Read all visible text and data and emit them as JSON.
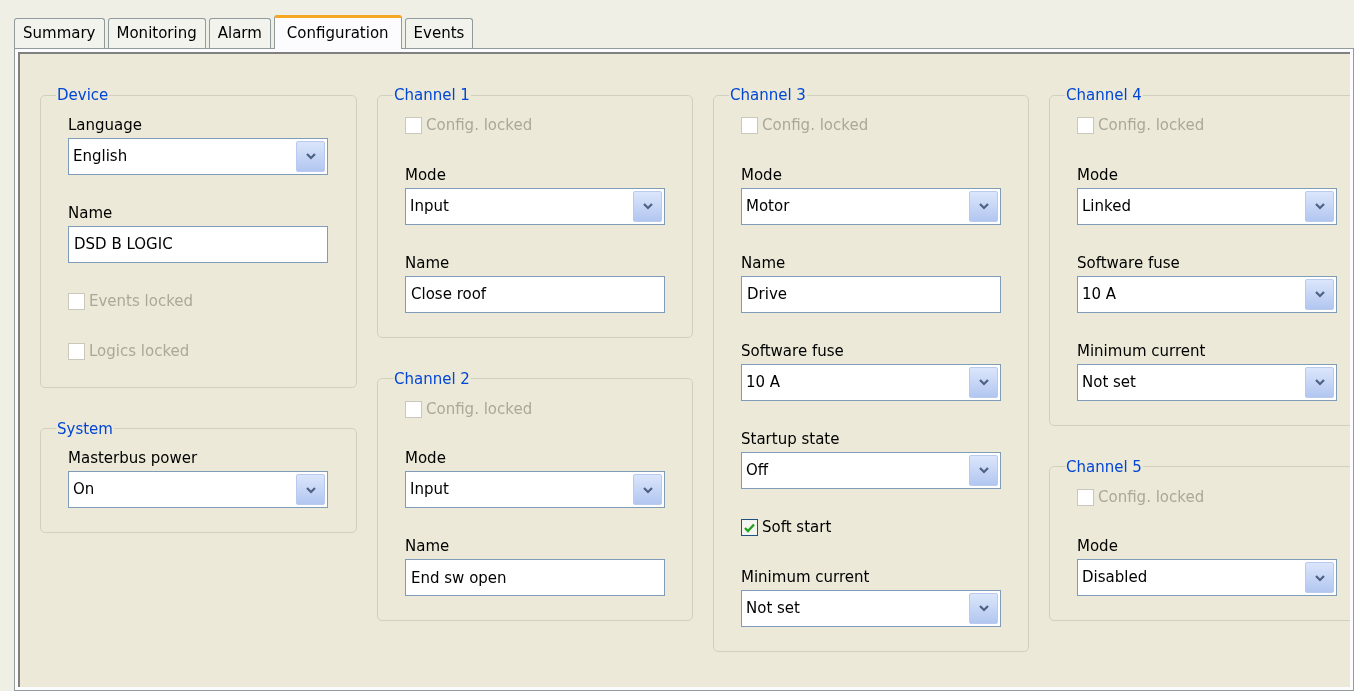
{
  "tabs": [
    {
      "label": "Summary",
      "selected": false
    },
    {
      "label": "Monitoring",
      "selected": false
    },
    {
      "label": "Alarm",
      "selected": false
    },
    {
      "label": "Configuration",
      "selected": true
    },
    {
      "label": "Events",
      "selected": false
    }
  ],
  "columns": [
    [
      {
        "title": "Device",
        "items": [
          {
            "kind": "select",
            "label": "Language",
            "value": "English"
          },
          {
            "kind": "text",
            "label": "Name",
            "value": "DSD B LOGIC"
          },
          {
            "kind": "checkbox",
            "label": "Events locked",
            "checked": false,
            "disabled": true
          },
          {
            "kind": "checkbox",
            "label": "Logics locked",
            "checked": false,
            "disabled": true
          }
        ]
      },
      {
        "title": "System",
        "items": [
          {
            "kind": "select",
            "label": "Masterbus power",
            "value": "On"
          }
        ]
      }
    ],
    [
      {
        "title": "Channel 1",
        "items": [
          {
            "kind": "checkbox",
            "label": "Config. locked",
            "checked": false,
            "disabled": true
          },
          {
            "kind": "select",
            "label": "Mode",
            "value": "Input"
          },
          {
            "kind": "text",
            "label": "Name",
            "value": "Close roof"
          }
        ]
      },
      {
        "title": "Channel 2",
        "items": [
          {
            "kind": "checkbox",
            "label": "Config. locked",
            "checked": false,
            "disabled": true
          },
          {
            "kind": "select",
            "label": "Mode",
            "value": "Input"
          },
          {
            "kind": "text",
            "label": "Name",
            "value": "End sw open"
          }
        ]
      }
    ],
    [
      {
        "title": "Channel 3",
        "items": [
          {
            "kind": "checkbox",
            "label": "Config. locked",
            "checked": false,
            "disabled": true
          },
          {
            "kind": "select",
            "label": "Mode",
            "value": "Motor"
          },
          {
            "kind": "text",
            "label": "Name",
            "value": "Drive"
          },
          {
            "kind": "select",
            "label": "Software fuse",
            "value": "10 A"
          },
          {
            "kind": "select",
            "label": "Startup state",
            "value": "Off"
          },
          {
            "kind": "checkbox",
            "label": "Soft start",
            "checked": true,
            "disabled": false
          },
          {
            "kind": "select",
            "label": "Minimum current",
            "value": "Not set"
          }
        ]
      }
    ],
    [
      {
        "title": "Channel 4",
        "items": [
          {
            "kind": "checkbox",
            "label": "Config. locked",
            "checked": false,
            "disabled": true
          },
          {
            "kind": "select",
            "label": "Mode",
            "value": "Linked"
          },
          {
            "kind": "select",
            "label": "Software fuse",
            "value": "10 A"
          },
          {
            "kind": "select",
            "label": "Minimum current",
            "value": "Not set"
          }
        ]
      },
      {
        "title": "Channel 5",
        "items": [
          {
            "kind": "checkbox",
            "label": "Config. locked",
            "checked": false,
            "disabled": true
          },
          {
            "kind": "select",
            "label": "Mode",
            "value": "Disabled"
          }
        ]
      }
    ]
  ]
}
